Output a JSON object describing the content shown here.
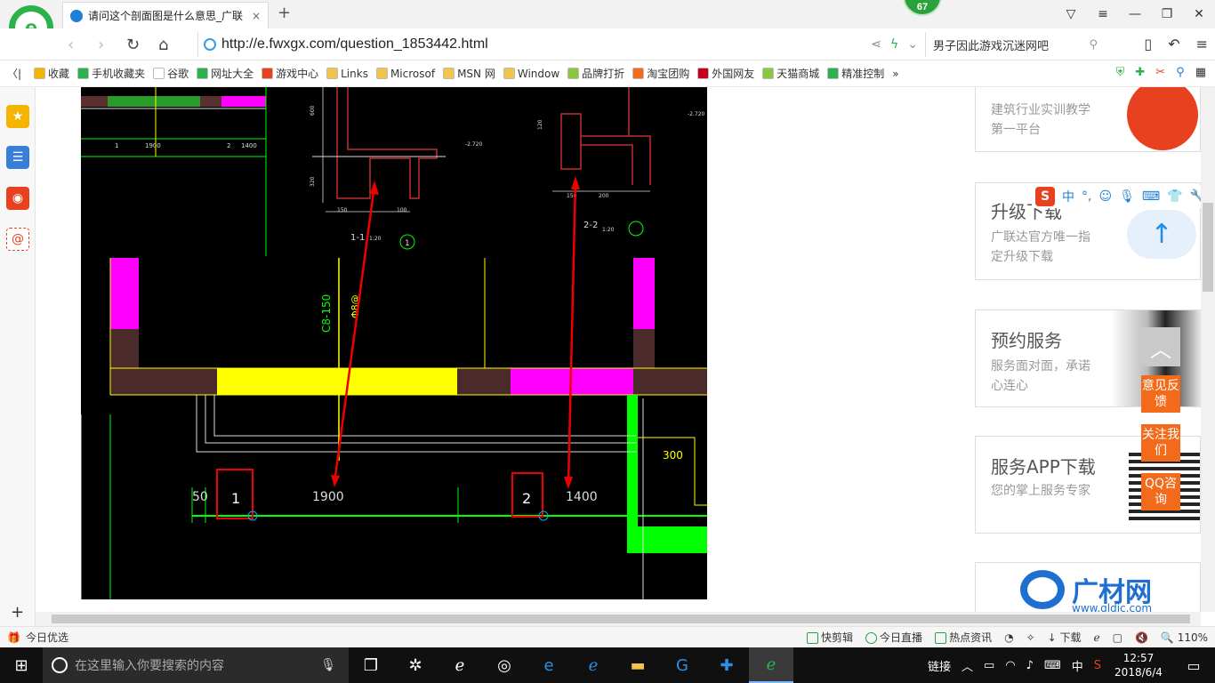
{
  "browser": {
    "tab_title": "请问这个剖面图是什么意思_广联",
    "tab_close": "×",
    "new_tab": "+",
    "badge": "67",
    "url": "http://e.fwxgx.com/question_1853442.html",
    "search_text": "男子因此游戏沉迷网吧",
    "logo_letter": "e"
  },
  "bookmarks": {
    "left_arrow": "〈|",
    "items": [
      {
        "label": "收藏",
        "color": "#f5b400"
      },
      {
        "label": "手机收藏夹",
        "color": "#2cb24a"
      },
      {
        "label": "谷歌",
        "color": "#ffffff"
      },
      {
        "label": "网址大全",
        "color": "#2cb24a"
      },
      {
        "label": "游戏中心",
        "color": "#e8411f"
      },
      {
        "label": "Links",
        "color": "#f3c44b"
      },
      {
        "label": "Microsof",
        "color": "#f3c44b"
      },
      {
        "label": "MSN 网",
        "color": "#f3c44b"
      },
      {
        "label": "Window",
        "color": "#f3c44b"
      },
      {
        "label": "品牌打折",
        "color": "#8cc63f"
      },
      {
        "label": "淘宝团购",
        "color": "#f26a1a"
      },
      {
        "label": "外国网友",
        "color": "#c4001c"
      },
      {
        "label": "天猫商城",
        "color": "#8cc63f"
      },
      {
        "label": "精准控制",
        "color": "#2cb24a"
      }
    ],
    "more": "»"
  },
  "cad": {
    "section1_label": "1-1",
    "section1_scale": "1:20",
    "section2_label": "2-2",
    "section2_scale": "1:20",
    "circle_label": "1",
    "rebar_label": "C8-150",
    "rebar_label2": "Φ8@",
    "dim_50": "50",
    "dim_1900": "1900",
    "dim_1400": "1400",
    "dim_300": "300",
    "box1": "1",
    "box2": "2",
    "small_dim_150a": "150",
    "small_dim_100": "100",
    "small_dim_150b": "150",
    "small_dim_200": "200",
    "small_dim_120": "120",
    "small_dim_600": "600",
    "small_dim_320": "320",
    "small_lvl_a": "-2.720",
    "small_lvl_b": "-2.720",
    "thumb_1900": "1900",
    "thumb_1400": "1400",
    "thumb_1": "1",
    "thumb_2": "2"
  },
  "ads": [
    {
      "title": "",
      "desc": "建筑行业实训教学第一平台"
    },
    {
      "title": "升级下载",
      "desc": "广联达官方唯一指定升级下载"
    },
    {
      "title": "预约服务",
      "desc": "服务面对面，承诺心连心"
    },
    {
      "title": "服务APP下载",
      "desc": "您的掌上服务专家"
    },
    {
      "title": "广材网",
      "desc": "www.gldjc.com"
    }
  ],
  "float_buttons": {
    "to_top": "︿",
    "feedback": "意见反馈",
    "follow": "关注我们",
    "qq": "QQ咨询"
  },
  "ime": {
    "logo": "S",
    "mode": "中",
    "punct": "°,"
  },
  "statusbar": {
    "left": "今日优选",
    "items": [
      "快剪辑",
      "今日直播",
      "热点资讯"
    ],
    "download": "下载",
    "zoom": "110%"
  },
  "taskbar": {
    "search_placeholder": "在这里输入你要搜索的内容",
    "tray_link": "链接",
    "ime": "中",
    "time": "12:57",
    "date": "2018/6/4"
  },
  "sidebar": {
    "add": "+"
  }
}
